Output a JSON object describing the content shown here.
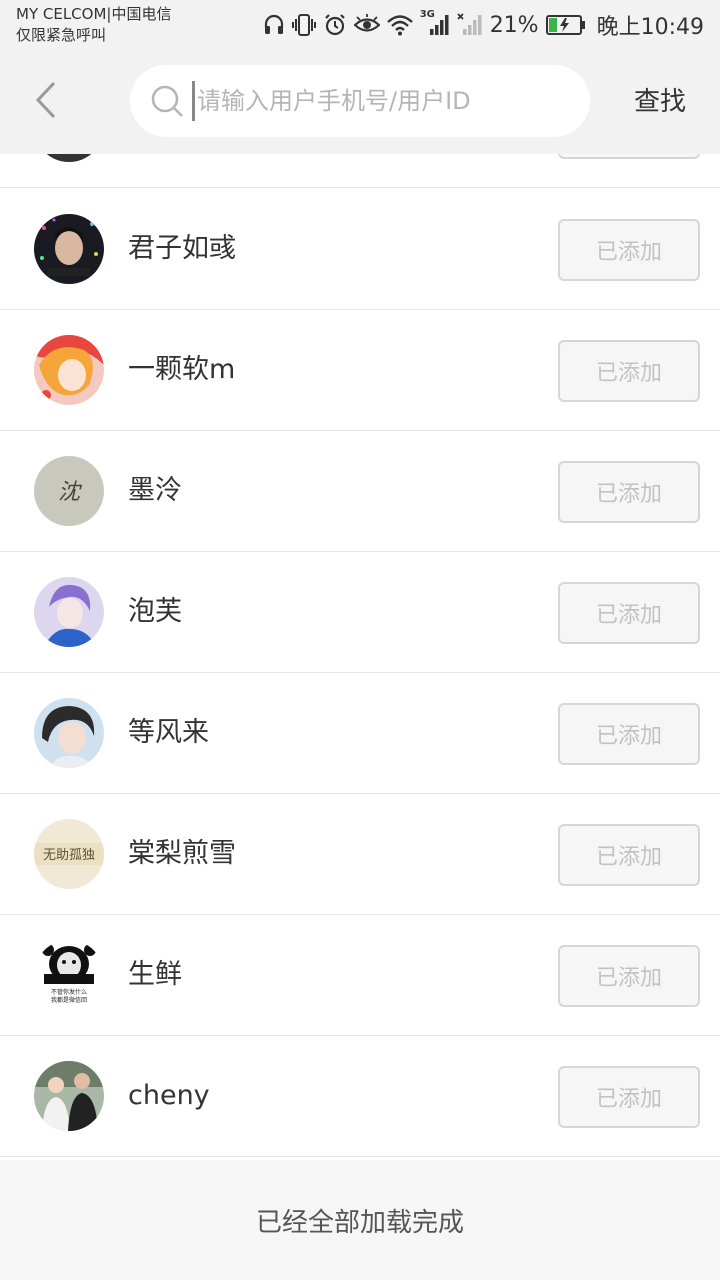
{
  "status_bar": {
    "carrier_line1": "MY CELCOM|中国电信",
    "carrier_line2": "仅限紧急呼叫",
    "network": "3G",
    "battery_percent": "21%",
    "time": "晚上10:49"
  },
  "header": {
    "search_placeholder": "请输入用户手机号/用户ID",
    "find_label": "查找"
  },
  "list": {
    "items": [
      {
        "name": "",
        "button": ""
      },
      {
        "name": "君子如彧",
        "button": "已添加"
      },
      {
        "name": "一颗软m",
        "button": "已添加"
      },
      {
        "name": "墨泠",
        "button": "已添加"
      },
      {
        "name": "泡芙",
        "button": "已添加"
      },
      {
        "name": "等风来",
        "button": "已添加"
      },
      {
        "name": "棠梨煎雪",
        "button": "已添加"
      },
      {
        "name": "生鲜",
        "button": "已添加"
      },
      {
        "name": "cheny",
        "button": "已添加"
      }
    ]
  },
  "footer": {
    "text": "已经全部加载完成"
  },
  "avatar_texts": {
    "mo_ling": "沈",
    "tang_li": "无助孤独",
    "sheng_xian_line1": "不管你发什么",
    "sheng_xian_line2": "我都是微信回"
  }
}
